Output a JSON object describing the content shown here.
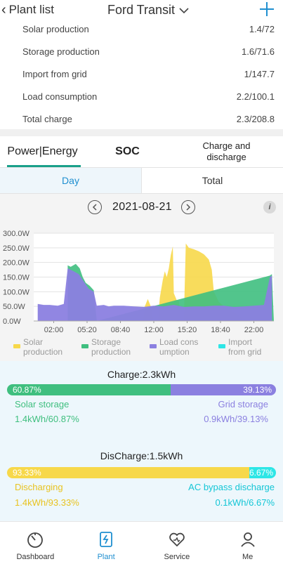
{
  "header": {
    "back_label": "Plant list",
    "title": "Ford Transit"
  },
  "stats": [
    {
      "label": "Solar production",
      "value": "1.4/72"
    },
    {
      "label": "Storage production",
      "value": "1.6/71.6"
    },
    {
      "label": "Import from grid",
      "value": "1/147.7"
    },
    {
      "label": "Load consumption",
      "value": "2.2/100.1"
    },
    {
      "label": "Total charge",
      "value": "2.3/208.8"
    }
  ],
  "tabs": [
    "Power|Energy",
    "SOC",
    "Charge and discharge"
  ],
  "subtabs": [
    "Day",
    "Total"
  ],
  "date": "2021-08-21",
  "chart_data": {
    "type": "area",
    "x_ticks": [
      "02:00",
      "05:20",
      "08:40",
      "12:00",
      "15:20",
      "18:40",
      "22:00"
    ],
    "y_ticks": [
      "0.0W",
      "50.0W",
      "100.0W",
      "150.0W",
      "200.0W",
      "250.0W",
      "300.0W"
    ],
    "ylim": [
      0,
      300
    ],
    "xlim_hours": [
      0,
      24
    ],
    "series": [
      {
        "name": "Solar production",
        "color": "#f7d84a",
        "points": [
          [
            10.9,
            0
          ],
          [
            11.1,
            50
          ],
          [
            11.4,
            75
          ],
          [
            11.7,
            50
          ],
          [
            12.0,
            0
          ],
          [
            12.4,
            0
          ],
          [
            12.6,
            80
          ],
          [
            12.9,
            140
          ],
          [
            13.1,
            170
          ],
          [
            13.3,
            150
          ],
          [
            13.5,
            180
          ],
          [
            13.7,
            225
          ],
          [
            13.9,
            255
          ],
          [
            14.0,
            95
          ],
          [
            14.3,
            70
          ],
          [
            14.5,
            70
          ],
          [
            14.7,
            0
          ],
          [
            15.0,
            0
          ],
          [
            15.2,
            265
          ],
          [
            15.5,
            250
          ],
          [
            16.0,
            245
          ],
          [
            16.5,
            238
          ],
          [
            17.0,
            228
          ],
          [
            17.5,
            210
          ],
          [
            17.8,
            175
          ],
          [
            18.0,
            100
          ],
          [
            18.5,
            65
          ],
          [
            19.0,
            50
          ],
          [
            19.5,
            40
          ],
          [
            20.5,
            20
          ],
          [
            21.0,
            0
          ]
        ]
      },
      {
        "name": "Storage production",
        "color": "#3fbf7f",
        "points": [
          [
            3.4,
            190
          ],
          [
            3.7,
            185
          ],
          [
            4.2,
            195
          ],
          [
            4.6,
            180
          ],
          [
            4.9,
            150
          ],
          [
            5.2,
            130
          ],
          [
            5.6,
            120
          ],
          [
            6.0,
            105
          ],
          [
            6.3,
            0
          ],
          [
            23.6,
            155
          ],
          [
            23.8,
            160
          ],
          [
            24,
            0
          ]
        ]
      },
      {
        "name": "Load consumption",
        "color": "#8b80e0",
        "points": [
          [
            0.4,
            58
          ],
          [
            1.0,
            55
          ],
          [
            1.6,
            55
          ],
          [
            2.4,
            52
          ],
          [
            3.0,
            58
          ],
          [
            3.4,
            180
          ],
          [
            3.7,
            175
          ],
          [
            4.0,
            170
          ],
          [
            4.5,
            160
          ],
          [
            5.0,
            135
          ],
          [
            5.5,
            110
          ],
          [
            6.0,
            100
          ],
          [
            6.3,
            52
          ],
          [
            7.0,
            55
          ],
          [
            7.5,
            50
          ],
          [
            8.0,
            52
          ],
          [
            9.0,
            52
          ],
          [
            10.0,
            50
          ],
          [
            11.0,
            48
          ],
          [
            12.0,
            52
          ],
          [
            13.0,
            50
          ],
          [
            14.0,
            55
          ],
          [
            15.0,
            48
          ],
          [
            16.0,
            50
          ],
          [
            17.0,
            50
          ],
          [
            18.0,
            52
          ],
          [
            19.0,
            52
          ],
          [
            20.0,
            48
          ],
          [
            21.0,
            50
          ],
          [
            22.0,
            52
          ],
          [
            23.0,
            55
          ],
          [
            23.6,
            150
          ],
          [
            23.8,
            155
          ]
        ]
      },
      {
        "name": "Import from grid",
        "color": "#2ee6e6",
        "points": []
      }
    ]
  },
  "charge": {
    "title": "Charge:2.3kWh",
    "left_pct": "60.87%",
    "right_pct": "39.13%",
    "left_value": 60.87,
    "left_label": "Solar storage",
    "right_label": "Grid storage",
    "left_detail": "1.4kWh/60.87%",
    "right_detail": "0.9kWh/39.13%",
    "left_color": "#3fbf7f",
    "right_color": "#8b80e0"
  },
  "discharge": {
    "title": "DisCharge:1.5kWh",
    "left_pct": "93.33%",
    "right_pct": "6.67%",
    "left_value": 93.33,
    "left_label": "Discharging",
    "right_label": "AC bypass discharge",
    "left_detail": "1.4kWh/93.33%",
    "right_detail": "0.1kWh/6.67%",
    "left_color": "#f7d84a",
    "right_color": "#2ee6e6"
  },
  "nav": [
    {
      "label": "Dashboard",
      "icon": "dashboard-icon"
    },
    {
      "label": "Plant",
      "icon": "plant-icon"
    },
    {
      "label": "Service",
      "icon": "service-icon"
    },
    {
      "label": "Me",
      "icon": "user-icon"
    }
  ]
}
